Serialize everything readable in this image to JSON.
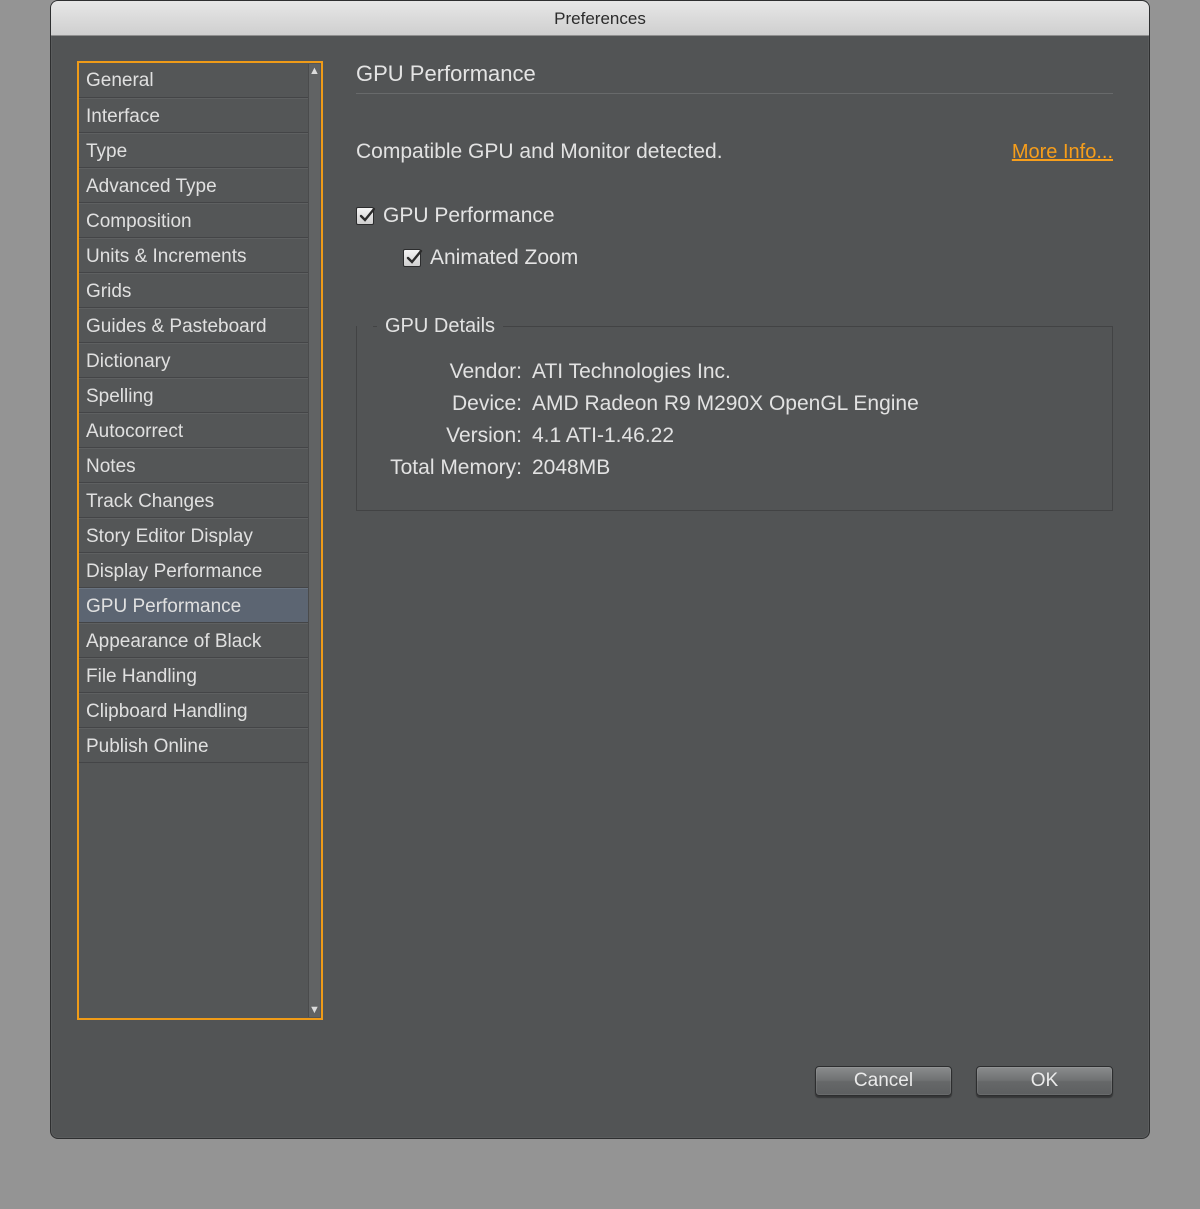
{
  "window": {
    "title": "Preferences"
  },
  "sidebar": {
    "items": [
      "General",
      "Interface",
      "Type",
      "Advanced Type",
      "Composition",
      "Units & Increments",
      "Grids",
      "Guides & Pasteboard",
      "Dictionary",
      "Spelling",
      "Autocorrect",
      "Notes",
      "Track Changes",
      "Story Editor Display",
      "Display Performance",
      "GPU Performance",
      "Appearance of Black",
      "File Handling",
      "Clipboard Handling",
      "Publish Online"
    ],
    "selected_index": 15
  },
  "main": {
    "title": "GPU Performance",
    "detected_text": "Compatible GPU and Monitor detected.",
    "more_info_label": "More Info...",
    "chk_gpu": {
      "label": "GPU Performance",
      "checked": true
    },
    "chk_zoom": {
      "label": "Animated Zoom",
      "checked": true
    },
    "group": {
      "legend": "GPU Details",
      "vendor": {
        "label": "Vendor:",
        "value": "ATI Technologies Inc."
      },
      "device": {
        "label": "Device:",
        "value": "AMD Radeon R9 M290X OpenGL Engine"
      },
      "version": {
        "label": "Version:",
        "value": "4.1 ATI-1.46.22"
      },
      "memory": {
        "label": "Total Memory:",
        "value": "2048MB"
      }
    }
  },
  "buttons": {
    "cancel": "Cancel",
    "ok": "OK"
  },
  "colors": {
    "accent": "#ef9b18",
    "link": "#f79e1b"
  }
}
